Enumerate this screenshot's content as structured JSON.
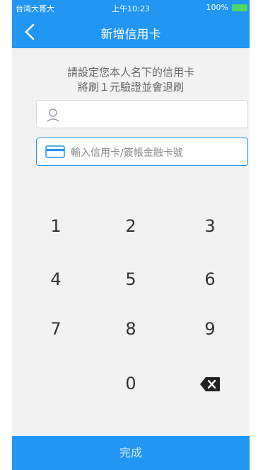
{
  "status_bar": {
    "carrier": "台湾大哥大",
    "time": "上午10:23",
    "battery": "100%"
  },
  "header": {
    "title": "新增信用卡"
  },
  "hint": {
    "line1": "請設定您本人名下的信用卡",
    "line2": "將刷１元驗證並會退刷"
  },
  "name_field": {
    "value": ""
  },
  "card_field": {
    "placeholder": "輸入信用卡/簽帳金融卡號"
  },
  "keypad": {
    "keys": [
      "1",
      "2",
      "3",
      "4",
      "5",
      "6",
      "7",
      "8",
      "9",
      "0"
    ]
  },
  "footer": {
    "done_label": "完成"
  },
  "colors": {
    "accent": "#2196f3"
  },
  "icons": [
    "back-chevron-icon",
    "user-icon",
    "credit-card-icon",
    "backspace-icon"
  ]
}
